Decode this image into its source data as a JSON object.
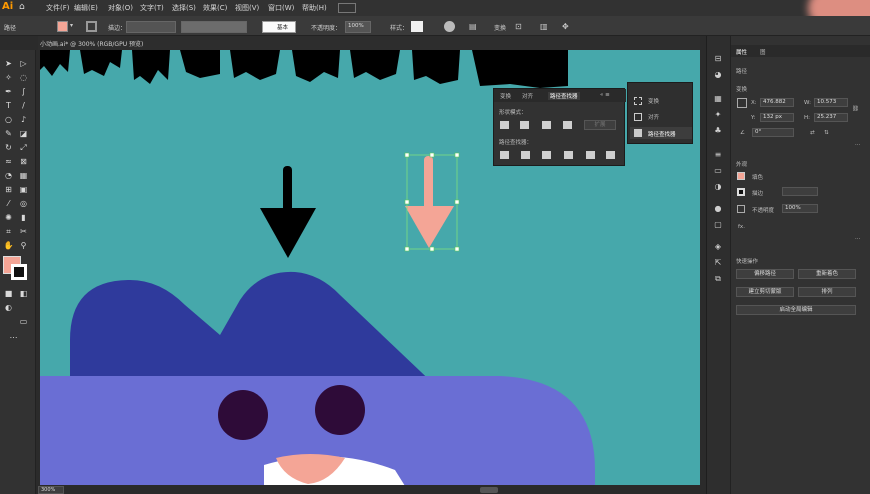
{
  "app": {
    "logo": "Ai"
  },
  "menu": [
    "文件(F)",
    "编辑(E)",
    "对象(O)",
    "文字(T)",
    "选择(S)",
    "效果(C)",
    "视图(V)",
    "窗口(W)",
    "帮助(H)"
  ],
  "control_bar": {
    "path_label": "路径",
    "stroke_label": "描边：",
    "stroke_style": "基本",
    "opacity_label": "不透明度：",
    "opacity_value": "100%",
    "style_label": "样式：",
    "transform_label": "变换"
  },
  "document_tab": "小动画.ai* @ 300% (RGB/GPU 预览)",
  "status_bar": {
    "zoom": "300%"
  },
  "pathfinder_panel": {
    "tabs": [
      "变换",
      "对齐",
      "路径查找器"
    ],
    "shape_modes_label": "形状模式：",
    "expand_label": "扩展",
    "pathfinders_label": "路径查找器："
  },
  "panel_menu": [
    "变换",
    "对齐",
    "路径查找器"
  ],
  "properties_panel": {
    "tabs": [
      "属性",
      "图"
    ],
    "section_path": "路径",
    "section_transform": "变换",
    "x_value": "476.882",
    "y_value": "132 px",
    "w_value": "10.573",
    "h_value": "25.237",
    "angle_value": "0°",
    "section_appearance": "外观",
    "fill_label": "填色",
    "stroke_label": "描边",
    "opacity_label": "不透明度",
    "opacity_value": "100%",
    "fx_label": "fx.",
    "quick_actions_label": "快速操作",
    "btn_offset_path": "偏移路径",
    "btn_rearrange": "重新着色",
    "btn_create_outline": "建立剪切蒙版",
    "btn_arrange": "排列",
    "btn_start_global_edit": "启动全局编辑"
  },
  "colors": {
    "canvas_bg": "#46a8ab",
    "dark_blue": "#2f3a9c",
    "lavender": "#6a6ed4",
    "pink": "#f4a596",
    "eye": "#2e0b38",
    "accent_fill": "#f4a596"
  }
}
